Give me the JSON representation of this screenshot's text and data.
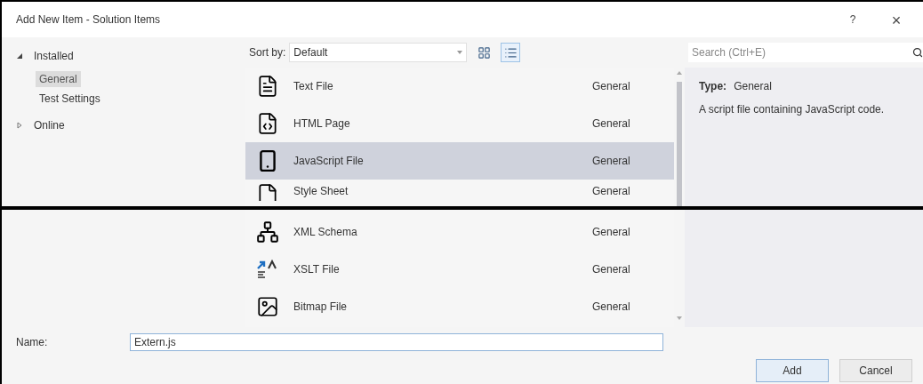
{
  "window": {
    "title": "Add New Item - Solution Items",
    "help": "?",
    "close": "×"
  },
  "tree": [
    {
      "label": "Installed",
      "expanded": true,
      "selected": false,
      "children": [
        {
          "label": "General",
          "selected": true
        },
        {
          "label": "Test Settings",
          "selected": false
        }
      ]
    },
    {
      "label": "Online",
      "expanded": false,
      "selected": false
    }
  ],
  "sort": {
    "label": "Sort by:",
    "value": "Default"
  },
  "views": [
    {
      "kind": "grid",
      "selected": false
    },
    {
      "kind": "list",
      "selected": true
    }
  ],
  "search": {
    "placeholder": "Search (Ctrl+E)"
  },
  "templates": [
    {
      "kind": "text",
      "name": "Text File",
      "category": "General",
      "selected": false
    },
    {
      "kind": "html",
      "name": "HTML Page",
      "category": "General",
      "selected": false
    },
    {
      "kind": "js",
      "name": "JavaScript File",
      "category": "General",
      "selected": true
    },
    {
      "kind": "css",
      "name": "Style Sheet",
      "category": "General",
      "selected": false
    },
    {
      "kind": "xml",
      "name": "XML Schema",
      "category": "General",
      "selected": false
    },
    {
      "kind": "xslt",
      "name": "XSLT File",
      "category": "General",
      "selected": false
    },
    {
      "kind": "bitmap",
      "name": "Bitmap File",
      "category": "General",
      "selected": false
    }
  ],
  "details": {
    "type_label": "Type:",
    "type_value": "General",
    "description": "A script file containing JavaScript code."
  },
  "name_field": {
    "label": "Name:",
    "value": "Extern.js"
  },
  "buttons": [
    {
      "kind": "primary",
      "label": "Add"
    },
    {
      "kind": "secondary",
      "label": "Cancel"
    }
  ]
}
